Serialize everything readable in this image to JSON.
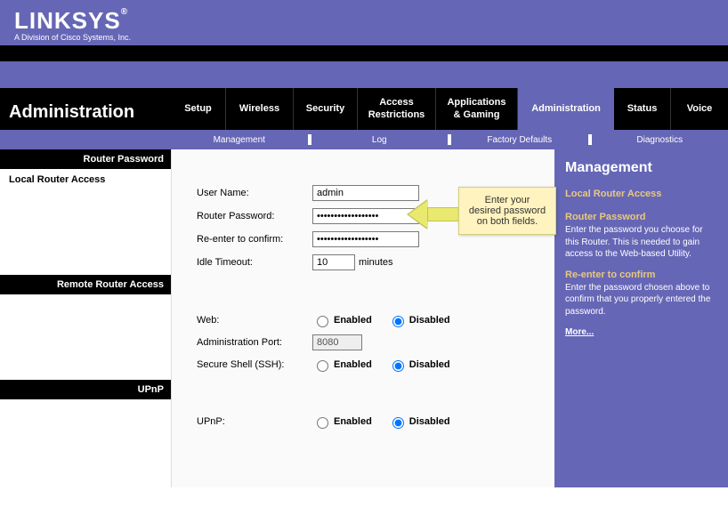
{
  "brand": "LINKSYS",
  "brand_suffix": "®",
  "brand_sub": "A Division of Cisco Systems, Inc.",
  "page_title": "Administration",
  "tabs": {
    "setup": "Setup",
    "wireless": "Wireless",
    "security": "Security",
    "access": "Access\nRestrictions",
    "apps": "Applications\n& Gaming",
    "admin": "Administration",
    "status": "Status",
    "voice": "Voice"
  },
  "subnav": {
    "management": "Management",
    "log": "Log",
    "factory": "Factory Defaults",
    "diag": "Diagnostics"
  },
  "left": {
    "router_password": "Router Password",
    "local_access": "Local Router Access",
    "remote_access": "Remote Router Access",
    "upnp": "UPnP"
  },
  "form": {
    "username_label": "User Name:",
    "username_value": "admin",
    "rp_label": "Router Password:",
    "rp_value": "••••••••••••••••••",
    "confirm_label": "Re-enter to confirm:",
    "confirm_value": "••••••••••••••••••",
    "idle_label": "Idle Timeout:",
    "idle_value": "10",
    "idle_unit": "minutes",
    "web_label": "Web:",
    "admin_port_label": "Administration Port:",
    "admin_port_value": "8080",
    "ssh_label": "Secure Shell (SSH):",
    "upnp_label": "UPnP:",
    "enabled": "Enabled",
    "disabled": "Disabled"
  },
  "callout_text": "Enter your desired password on both fields.",
  "help": {
    "title": "Management",
    "h1": "Local Router Access",
    "h2": "Router Password",
    "p2": "Enter the password you choose for this Router. This is needed to gain access to the Web-based Utility.",
    "h3": "Re-enter to confirm",
    "p3": "Enter the password chosen above to confirm that you properly entered the password.",
    "more": "More..."
  }
}
